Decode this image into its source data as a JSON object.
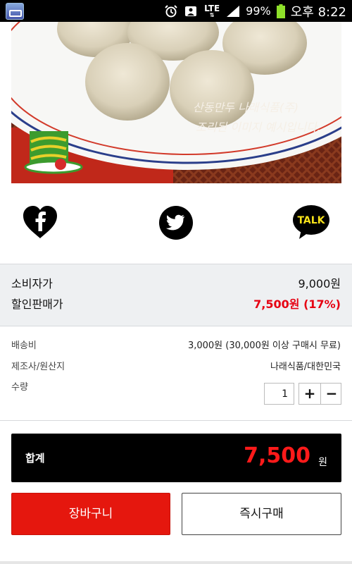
{
  "status_bar": {
    "signal_text": "LTE",
    "battery_percent": "99%",
    "time": "오후 8:22"
  },
  "product": {
    "image_caption_line1": "산동만두 나래식품(주)",
    "image_caption_line2": "조리된 이미지 예시입니다."
  },
  "share": {
    "facebook_icon": "facebook-heart-icon",
    "twitter_icon": "twitter-bird-icon",
    "kakao_label": "TALK"
  },
  "price": {
    "list_label": "소비자가",
    "list_value": "9,000원",
    "sale_label": "할인판매가",
    "sale_value": "7,500원 (17%)"
  },
  "info": {
    "shipping_label": "배송비",
    "shipping_value": "3,000원 (30,000원 이상 구매시 무료)",
    "maker_label": "제조사/원산지",
    "maker_value": "나래식품/대한민국",
    "qty_label": "수량",
    "qty_value": "1",
    "plus_label": "+",
    "minus_label": "−"
  },
  "total": {
    "label": "합계",
    "amount": "7,500",
    "unit": "원"
  },
  "actions": {
    "cart_label": "장바구니",
    "buy_label": "즉시구매"
  },
  "colors": {
    "accent_red": "#e5170e",
    "sale_red": "#e60012",
    "total_bg": "#000000"
  }
}
